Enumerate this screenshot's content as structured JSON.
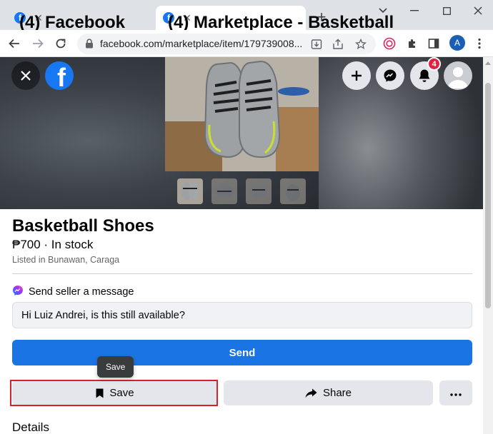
{
  "browser": {
    "tabs": [
      {
        "title": "(4) Facebook",
        "active": false
      },
      {
        "title": "(4) Marketplace - Basketball",
        "active": true
      }
    ],
    "address": "facebook.com/marketplace/item/179739008...",
    "profile_initial": "A",
    "icons": [
      "back-arrow-icon",
      "forward-arrow-icon",
      "reload-icon",
      "lock-icon",
      "install-app-icon",
      "share-page-icon",
      "bookmark-star-icon",
      "extension-target-icon",
      "puzzle-extension-icon",
      "side-panel-icon",
      "kebab-menu-icon"
    ]
  },
  "header": {
    "notification_count": "4",
    "icons": [
      "close-icon",
      "facebook-logo-icon",
      "plus-icon",
      "messenger-icon",
      "bell-icon",
      "avatar"
    ]
  },
  "gallery": {
    "thumbnail_count": 4,
    "selected_index": 0
  },
  "listing": {
    "title": "Basketball Shoes",
    "price": "₱700 · In stock",
    "location": "Listed in Bunawan, Caraga"
  },
  "message": {
    "heading": "Send seller a message",
    "input_value": "Hi Luiz Andrei, is this still available?",
    "send_label": "Send"
  },
  "actions": {
    "tooltip": "Save",
    "save_label": "Save",
    "share_label": "Share"
  },
  "details_heading": "Details",
  "colors": {
    "facebook_blue": "#1877f2",
    "send_button": "#1b74e4",
    "secondary_button": "#e4e6eb",
    "highlight_red": "#d6212b",
    "notification_badge": "#e41e3f"
  }
}
